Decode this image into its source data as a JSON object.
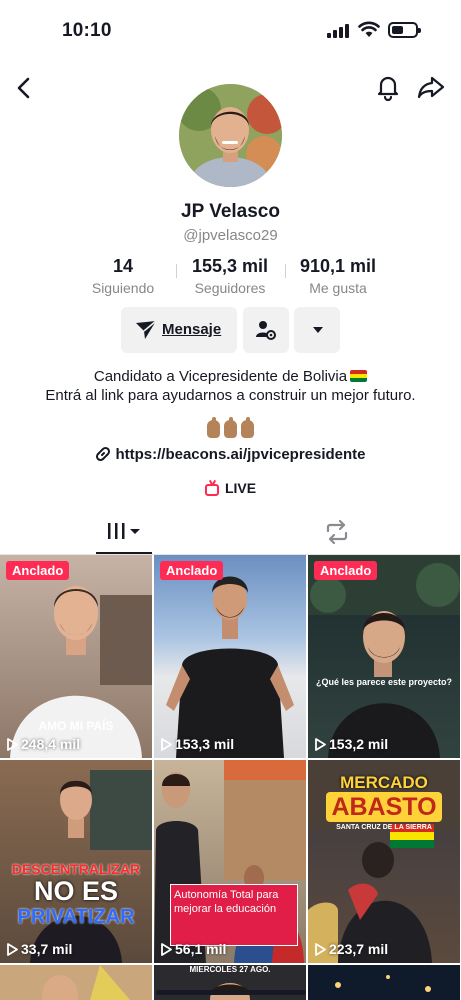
{
  "status_bar": {
    "time": "10:10"
  },
  "profile": {
    "name": "JP Velasco",
    "handle": "@jpvelasco29",
    "stats": [
      {
        "value": "14",
        "label": "Siguiendo"
      },
      {
        "value": "155,3 mil",
        "label": "Seguidores"
      },
      {
        "value": "910,1 mil",
        "label": "Me gusta"
      }
    ],
    "message_button_label": "Mensaje",
    "bio_line1": "Candidato a Vicepresidente de Bolivia",
    "bio_line2": "Entrá al link para ayudarnos a construir un mejor futuro.",
    "link_text": "https://beacons.ai/jpvicepresidente",
    "live_label": "LIVE"
  },
  "icons": {
    "back": "chevron-left-icon",
    "bell": "bell-icon",
    "share": "share-icon",
    "send": "send-icon",
    "follow_settings": "user-gear-icon",
    "more": "caret-down-icon",
    "link": "link-icon",
    "videos_tab": "grid-icon",
    "reposts_tab": "repost-icon",
    "play": "play-icon"
  },
  "videos": [
    {
      "pinned_label": "Anclado",
      "views": "248,4 mil",
      "caption": "AMO MI PAÍS"
    },
    {
      "pinned_label": "Anclado",
      "views": "153,3 mil",
      "caption": ""
    },
    {
      "pinned_label": "Anclado",
      "views": "153,2 mil",
      "caption": "¿Qué les parece este proyecto?"
    },
    {
      "pinned_label": "",
      "views": "33,7 mil",
      "caption_line1": "DESCENTRALIZAR",
      "caption_line2": "NO ES",
      "caption_line3": "PRIVATIZAR"
    },
    {
      "pinned_label": "",
      "views": "56,1 mil",
      "caption": "Autonomía Total para mejorar la educación"
    },
    {
      "pinned_label": "",
      "views": "223,7 mil",
      "caption_line1": "MERCADO",
      "caption_line2": "ABASTO",
      "caption_line3": "SANTA CRUZ DE LA SIERRA"
    },
    {
      "caption": "MIERCOLES 27 AGO."
    }
  ],
  "colors": {
    "accent": "#fe2c55",
    "text": "#161823",
    "muted": "#86878b"
  }
}
